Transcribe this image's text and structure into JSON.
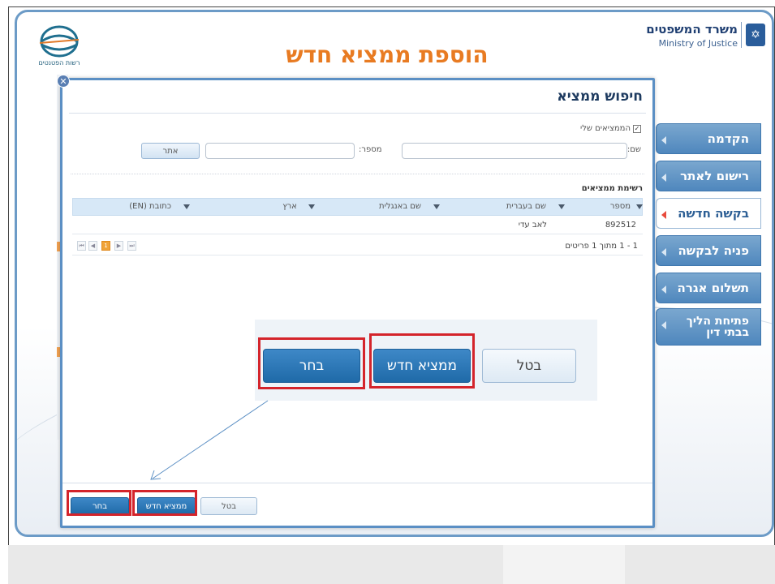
{
  "header": {
    "ministry_he": "משרד המשפטים",
    "ministry_en": "Ministry of Justice",
    "patents_caption": "רשות הפטנטים",
    "page_heading": "הוספת ממציא חדש"
  },
  "nav": {
    "items": [
      {
        "label": "הקדמה",
        "active": false
      },
      {
        "label": "רישום לאתר",
        "active": false
      },
      {
        "label": "בקשה חדשה",
        "active": true
      },
      {
        "label": "פניה לבקשה",
        "active": false
      },
      {
        "label": "תשלום אגרה",
        "active": false
      },
      {
        "label": "פתיחת הליך בבתי דין",
        "active": false
      }
    ]
  },
  "modal": {
    "title": "חיפוש ממציא",
    "my_inventors_label": "הממציאים שלי",
    "name_label": "שם:",
    "number_label": "מספר:",
    "search_button": "אתר",
    "list_title": "רשימת ממציאים",
    "columns": [
      "מספר",
      "שם בעברית",
      "שם באנגלית",
      "ארץ",
      "כתובת (EN)"
    ],
    "rows": [
      {
        "number": "892512",
        "name_he": "לאב עדי",
        "name_en": "",
        "country": "",
        "address_en": ""
      }
    ],
    "pager": {
      "current_page": "1",
      "info": "1 - 1 מתוך 1 פריטים"
    },
    "footer": {
      "select": "בחר",
      "new_inventor": "ממציא חדש",
      "cancel": "בטל"
    }
  },
  "zoom": {
    "select": "בחר",
    "new_inventor": "ממציא חדש",
    "cancel": "בטל"
  },
  "colors": {
    "heading_orange": "#e87b22",
    "nav_blue": "#4f87bd",
    "button_blue": "#1f6aa8",
    "highlight_red": "#d4242b"
  }
}
